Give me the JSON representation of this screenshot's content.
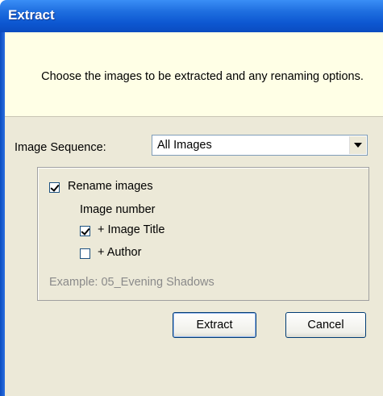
{
  "window": {
    "title": "Extract"
  },
  "header": {
    "instruction": "Choose the images to be extracted and any renaming options."
  },
  "sequence": {
    "label": "Image Sequence:",
    "selected": "All Images"
  },
  "rename": {
    "checkbox_label": "Rename images",
    "checked": true,
    "image_number_label": "Image number",
    "image_title": {
      "label": "+ Image Title",
      "checked": true
    },
    "author": {
      "label": "+ Author",
      "checked": false
    },
    "example": "Example: 05_Evening Shadows"
  },
  "buttons": {
    "extract": "Extract",
    "cancel": "Cancel"
  }
}
